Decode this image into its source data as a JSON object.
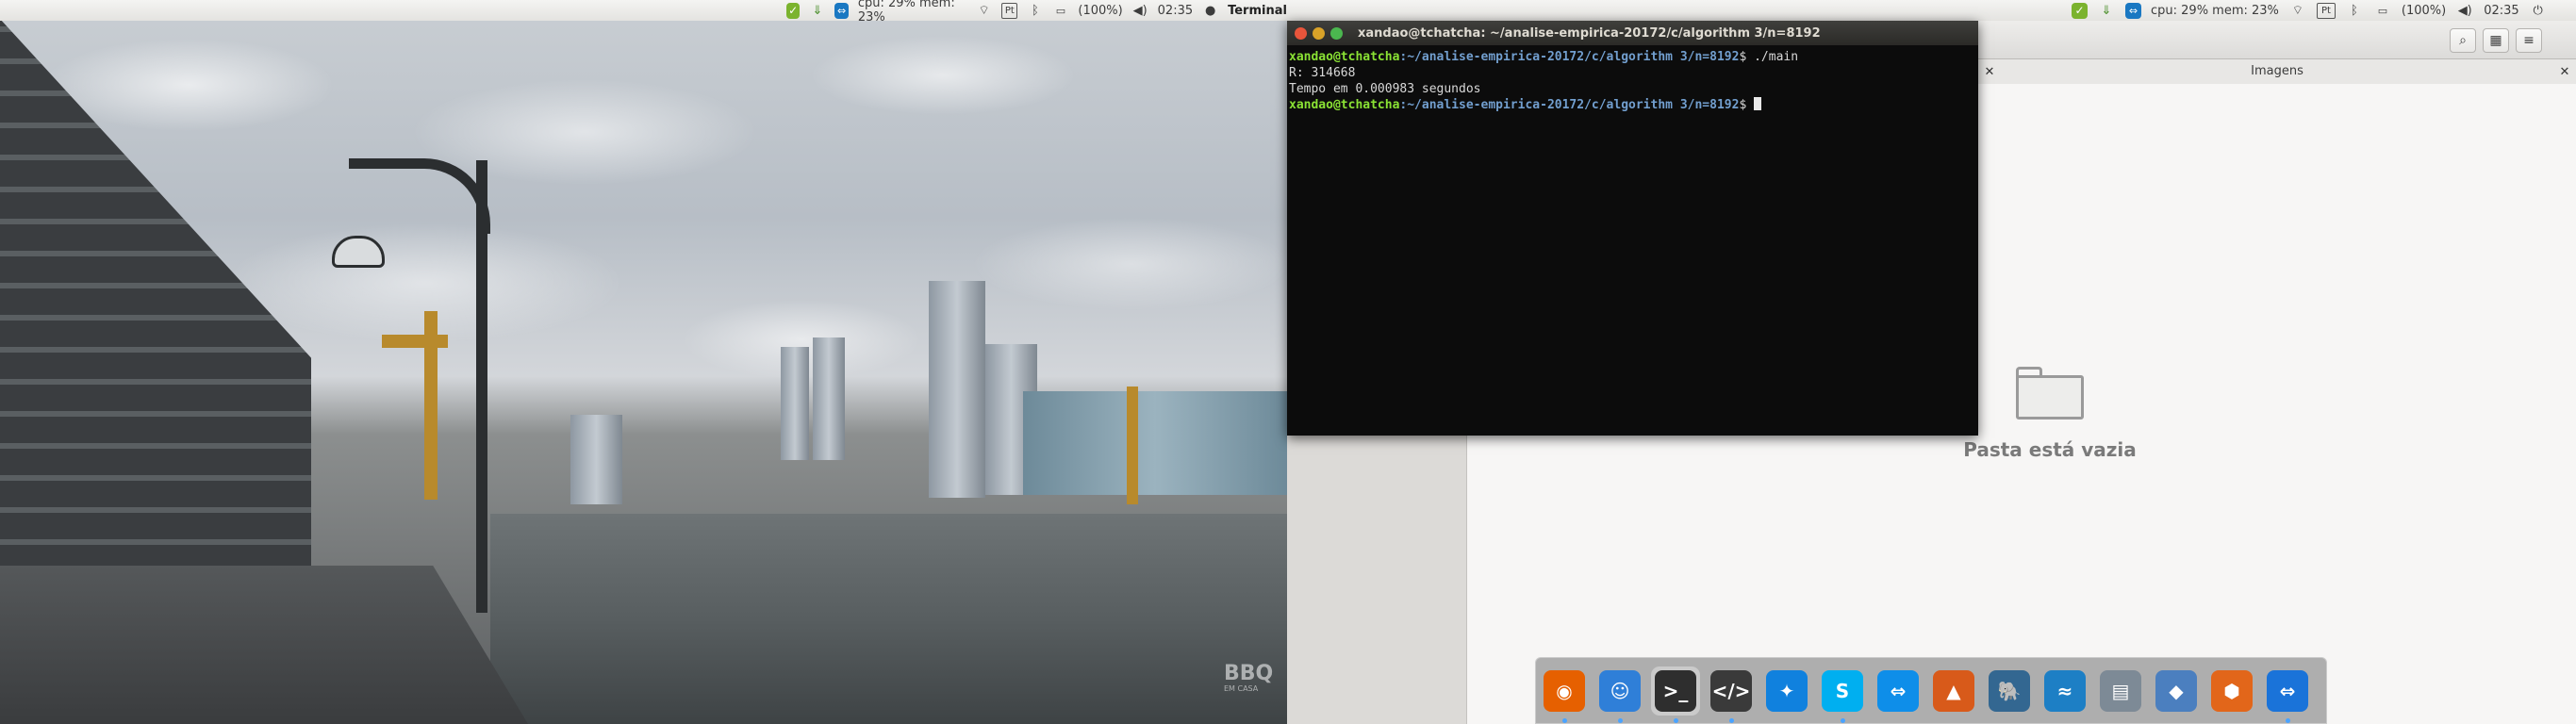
{
  "panel_left": {
    "cpu_mem": "cpu: 29% mem: 23%",
    "keyboard": "Pt",
    "battery": "(100%)",
    "time": "02:35",
    "active_app": "Terminal"
  },
  "panel_right": {
    "cpu_mem": "cpu: 29% mem: 23%",
    "keyboard": "Pt",
    "battery": "(100%)",
    "time": "02:35"
  },
  "terminal": {
    "title": "xandao@tchatcha: ~/analise-empirica-20172/c/algorithm 3/n=8192",
    "lines": [
      {
        "user": "xandao@tchatcha",
        "path": ":~/analise-empirica-20172/c/algorithm 3/n=8192",
        "cmd": "$ ./main"
      },
      {
        "text": "R: 314668"
      },
      {
        "text": "Tempo em 0.000983 segundos"
      },
      {
        "user": "xandao@tchatcha",
        "path": ":~/analise-empirica-20172/c/algorithm 3/n=8192",
        "cmd": "$ "
      }
    ]
  },
  "files": {
    "tab_label": "Imagens",
    "empty_message": "Pasta está vazia"
  },
  "wallpaper": {
    "watermark": "BBQ",
    "watermark_sub": "EM CASA"
  },
  "dock": {
    "items": [
      {
        "name": "firefox-icon",
        "glyph": "◉",
        "color": "#e66000",
        "active": true
      },
      {
        "name": "finder-icon",
        "glyph": "☺",
        "color": "#2f7fd8",
        "active": true
      },
      {
        "name": "terminal-icon",
        "glyph": ">_",
        "color": "#2e2e2e",
        "active": true
      },
      {
        "name": "code-editor-icon",
        "glyph": "</>",
        "color": "#3a3a3a",
        "active": true
      },
      {
        "name": "dropbox-icon",
        "glyph": "✦",
        "color": "#1081de",
        "active": false
      },
      {
        "name": "skype-icon",
        "glyph": "S",
        "color": "#00aff0",
        "active": true
      },
      {
        "name": "teamviewer-icon",
        "glyph": "⇔",
        "color": "#0e8ee9",
        "active": false
      },
      {
        "name": "matlab-icon",
        "glyph": "▲",
        "color": "#d85a1a",
        "active": false
      },
      {
        "name": "postgresql-icon",
        "glyph": "🐘",
        "color": "#336791",
        "active": false
      },
      {
        "name": "mysql-workbench-icon",
        "glyph": "≈",
        "color": "#1d7fc5",
        "active": false
      },
      {
        "name": "screenshot-icon",
        "glyph": "▤",
        "color": "#7d8a96",
        "active": false
      },
      {
        "name": "virtualbox-icon",
        "glyph": "◆",
        "color": "#4b7fbf",
        "active": false
      },
      {
        "name": "network-app-icon",
        "glyph": "⬢",
        "color": "#e2661a",
        "active": false
      },
      {
        "name": "teamviewer-alt-icon",
        "glyph": "⇔",
        "color": "#1a73d9",
        "active": true
      }
    ]
  }
}
